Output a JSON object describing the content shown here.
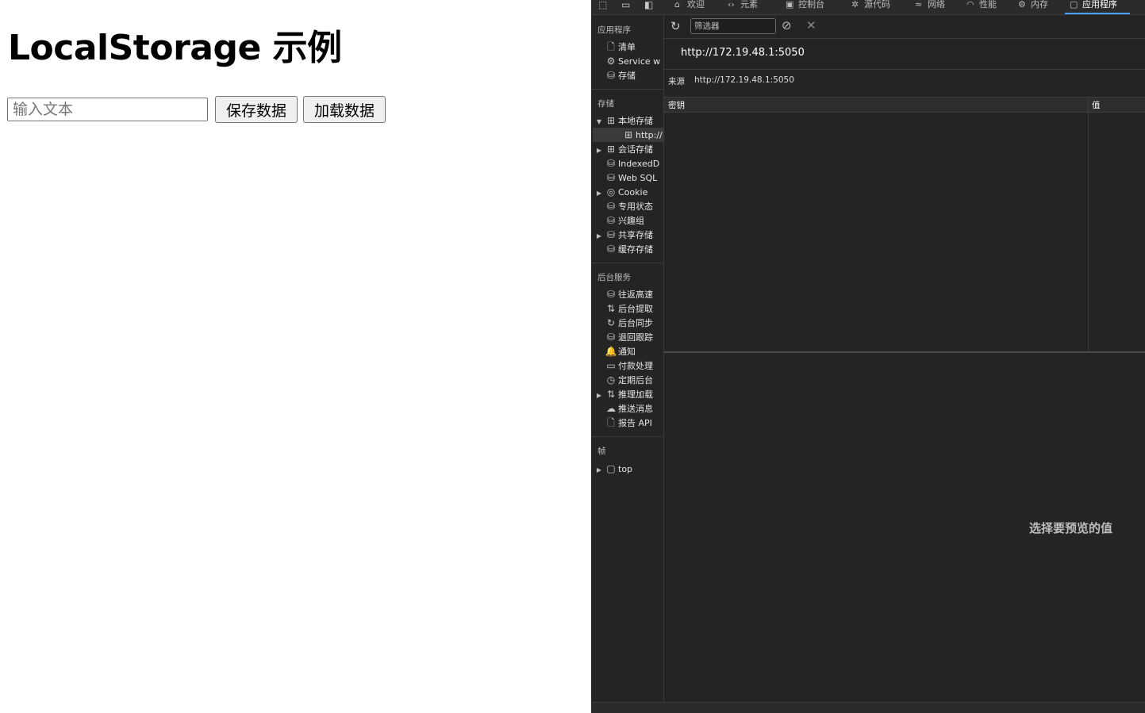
{
  "page": {
    "heading": "LocalStorage 示例",
    "input_placeholder": "输入文本",
    "save_button": "保存数据",
    "load_button": "加载数据"
  },
  "devtools": {
    "tabs": [
      {
        "icon": "home-icon",
        "label": "欢迎"
      },
      {
        "icon": "code-icon",
        "label": "元素"
      },
      {
        "icon": "console-icon",
        "label": "控制台"
      },
      {
        "icon": "bug-icon",
        "label": "源代码"
      },
      {
        "icon": "wifi-icon",
        "label": "网络"
      },
      {
        "icon": "gauge-icon",
        "label": "性能"
      },
      {
        "icon": "chip-icon",
        "label": "内存"
      },
      {
        "icon": "window-icon",
        "label": "应用程序",
        "active": true
      }
    ],
    "sidebar": {
      "app_header": "应用程序",
      "app_items": [
        "清单",
        "Service w",
        "存储"
      ],
      "storage_header": "存储",
      "storage_items": [
        {
          "label": "本地存储",
          "expanded": true
        },
        {
          "label": "http://",
          "selected": true
        },
        {
          "label": "会话存储",
          "expandable": true
        },
        {
          "label": "IndexedD"
        },
        {
          "label": "Web SQL"
        },
        {
          "label": "Cookie",
          "expandable": true
        },
        {
          "label": "专用状态"
        },
        {
          "label": "兴趣组"
        },
        {
          "label": "共享存储",
          "expandable": true
        },
        {
          "label": "缓存存储"
        }
      ],
      "bg_header": "后台服务",
      "bg_items": [
        "往返高速",
        "后台提取",
        "后台同步",
        "退回跟踪",
        "通知",
        "付款处理",
        "定期后台",
        "推理加载",
        "推送消息",
        "报告 API"
      ],
      "frames_header": "帧",
      "frames_items": [
        "top"
      ]
    },
    "main": {
      "filter_placeholder": "筛选器",
      "origin_url": "http://172.19.48.1:5050",
      "origin_label": "来源",
      "origin_value": "http://172.19.48.1:5050",
      "col_key": "密钥",
      "col_value": "值",
      "preview_text": "选择要预览的值"
    },
    "colors": {
      "background": "#242424",
      "accent": "#4aa3ff"
    }
  }
}
